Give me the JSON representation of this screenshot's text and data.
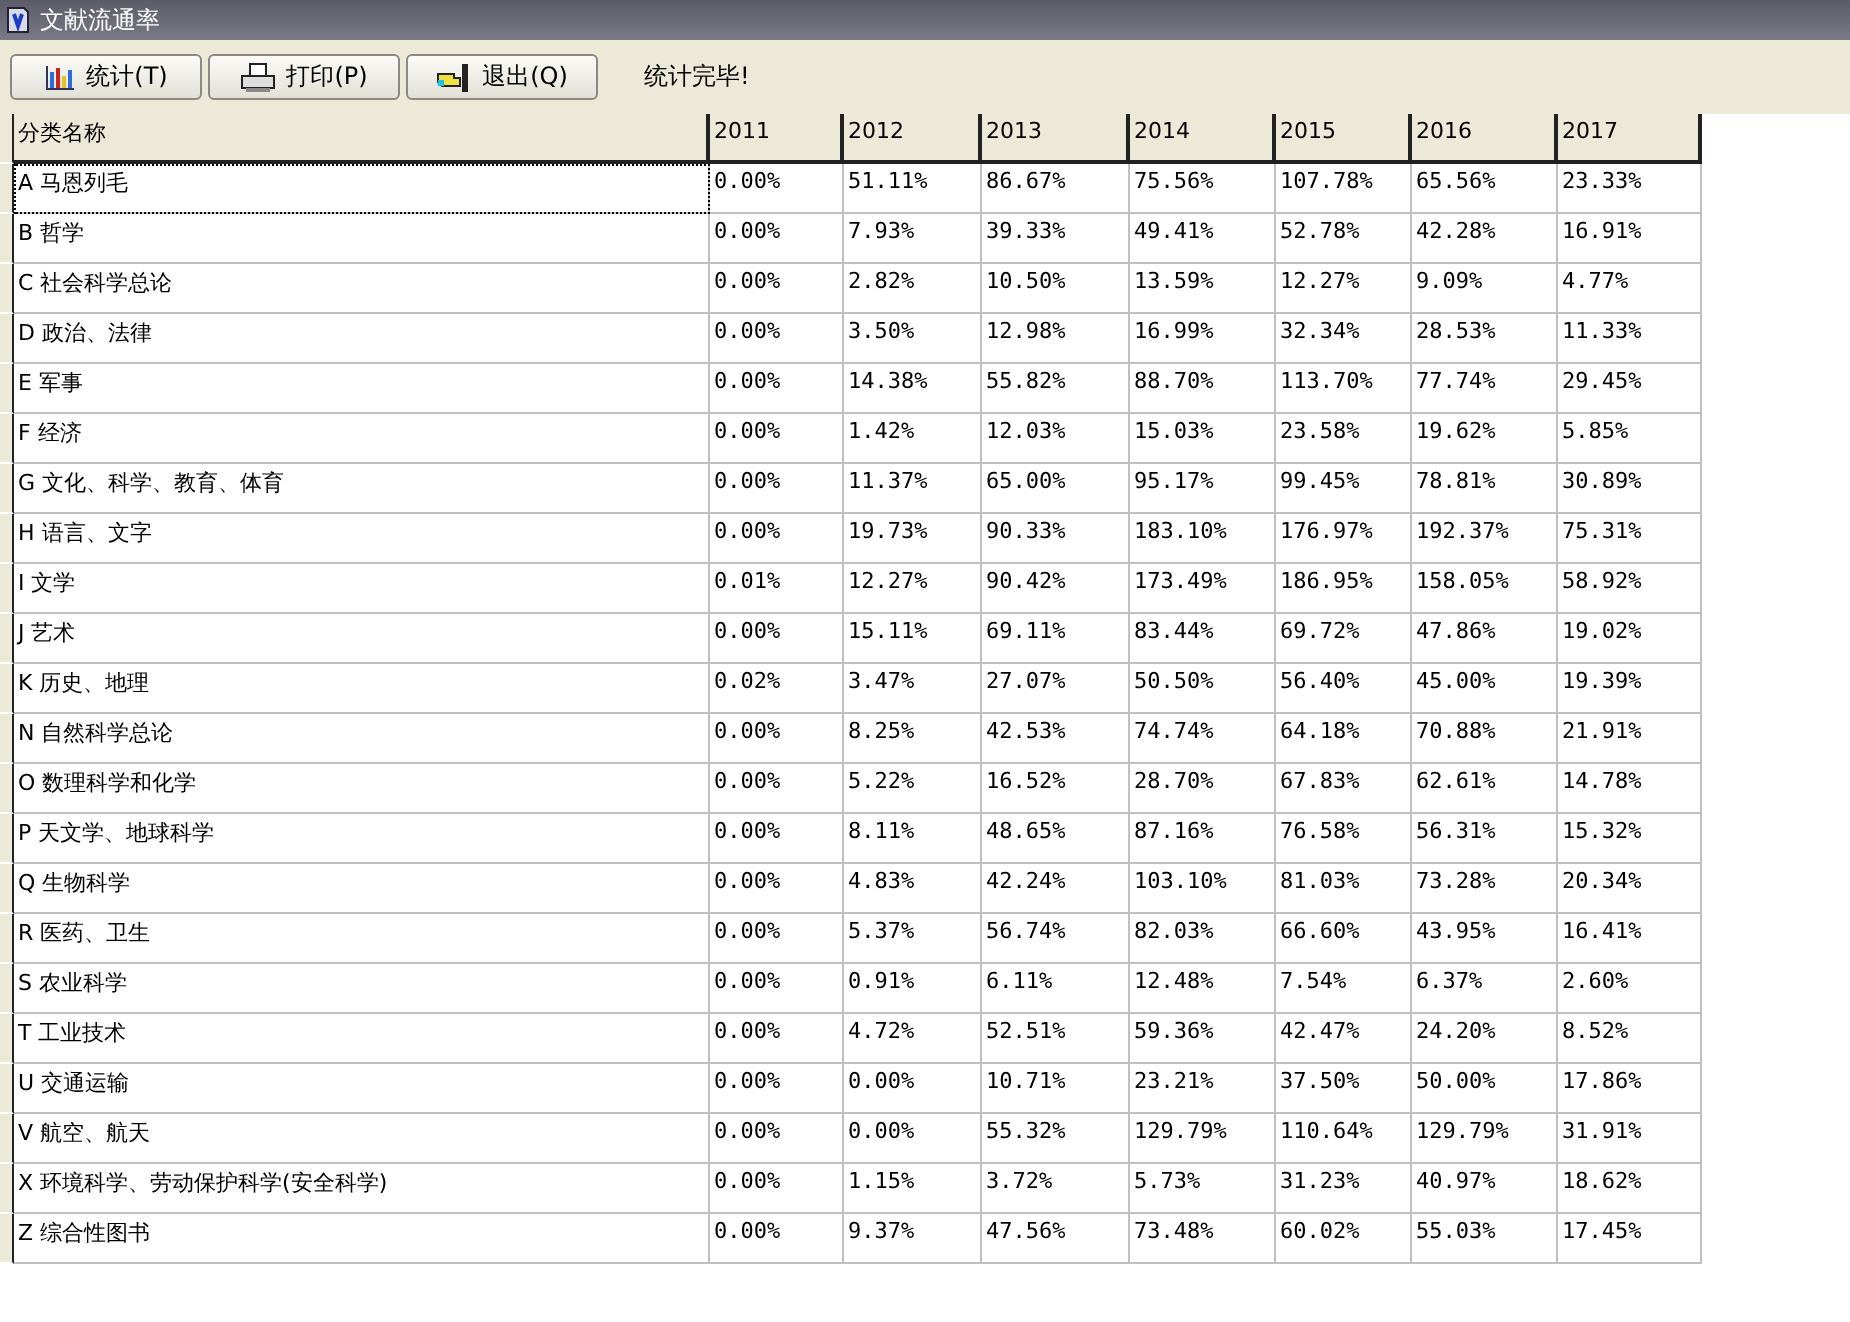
{
  "window": {
    "title": "文献流通率"
  },
  "toolbar": {
    "buttons": [
      {
        "kind": "chart",
        "label": "统计(T)"
      },
      {
        "kind": "print",
        "label": "打印(P)"
      },
      {
        "kind": "exit",
        "label": "退出(Q)"
      }
    ],
    "status": "统计完毕!"
  },
  "table": {
    "columns": [
      "分类名称",
      "2011",
      "2012",
      "2013",
      "2014",
      "2015",
      "2016",
      "2017"
    ],
    "rows": [
      {
        "focused": true,
        "cells": [
          "A 马恩列毛",
          "0.00%",
          "51.11%",
          "86.67%",
          "75.56%",
          "107.78%",
          "65.56%",
          "23.33%"
        ]
      },
      {
        "focused": false,
        "cells": [
          "B 哲学",
          "0.00%",
          "7.93%",
          "39.33%",
          "49.41%",
          "52.78%",
          "42.28%",
          "16.91%"
        ]
      },
      {
        "focused": false,
        "cells": [
          "C 社会科学总论",
          "0.00%",
          "2.82%",
          "10.50%",
          "13.59%",
          "12.27%",
          "9.09%",
          "4.77%"
        ]
      },
      {
        "focused": false,
        "cells": [
          "D 政治、法律",
          "0.00%",
          "3.50%",
          "12.98%",
          "16.99%",
          "32.34%",
          "28.53%",
          "11.33%"
        ]
      },
      {
        "focused": false,
        "cells": [
          "E 军事",
          "0.00%",
          "14.38%",
          "55.82%",
          "88.70%",
          "113.70%",
          "77.74%",
          "29.45%"
        ]
      },
      {
        "focused": false,
        "cells": [
          "F 经济",
          "0.00%",
          "1.42%",
          "12.03%",
          "15.03%",
          "23.58%",
          "19.62%",
          "5.85%"
        ]
      },
      {
        "focused": false,
        "cells": [
          "G 文化、科学、教育、体育",
          "0.00%",
          "11.37%",
          "65.00%",
          "95.17%",
          "99.45%",
          "78.81%",
          "30.89%"
        ]
      },
      {
        "focused": false,
        "cells": [
          "H 语言、文字",
          "0.00%",
          "19.73%",
          "90.33%",
          "183.10%",
          "176.97%",
          "192.37%",
          "75.31%"
        ]
      },
      {
        "focused": false,
        "cells": [
          "I 文学",
          "0.01%",
          "12.27%",
          "90.42%",
          "173.49%",
          "186.95%",
          "158.05%",
          "58.92%"
        ]
      },
      {
        "focused": false,
        "cells": [
          "J 艺术",
          "0.00%",
          "15.11%",
          "69.11%",
          "83.44%",
          "69.72%",
          "47.86%",
          "19.02%"
        ]
      },
      {
        "focused": false,
        "cells": [
          "K 历史、地理",
          "0.02%",
          "3.47%",
          "27.07%",
          "50.50%",
          "56.40%",
          "45.00%",
          "19.39%"
        ]
      },
      {
        "focused": false,
        "cells": [
          "N 自然科学总论",
          "0.00%",
          "8.25%",
          "42.53%",
          "74.74%",
          "64.18%",
          "70.88%",
          "21.91%"
        ]
      },
      {
        "focused": false,
        "cells": [
          "O 数理科学和化学",
          "0.00%",
          "5.22%",
          "16.52%",
          "28.70%",
          "67.83%",
          "62.61%",
          "14.78%"
        ]
      },
      {
        "focused": false,
        "cells": [
          "P 天文学、地球科学",
          "0.00%",
          "8.11%",
          "48.65%",
          "87.16%",
          "76.58%",
          "56.31%",
          "15.32%"
        ]
      },
      {
        "focused": false,
        "cells": [
          "Q 生物科学",
          "0.00%",
          "4.83%",
          "42.24%",
          "103.10%",
          "81.03%",
          "73.28%",
          "20.34%"
        ]
      },
      {
        "focused": false,
        "cells": [
          "R 医药、卫生",
          "0.00%",
          "5.37%",
          "56.74%",
          "82.03%",
          "66.60%",
          "43.95%",
          "16.41%"
        ]
      },
      {
        "focused": false,
        "cells": [
          "S 农业科学",
          "0.00%",
          "0.91%",
          "6.11%",
          "12.48%",
          "7.54%",
          "6.37%",
          "2.60%"
        ]
      },
      {
        "focused": false,
        "cells": [
          "T 工业技术",
          "0.00%",
          "4.72%",
          "52.51%",
          "59.36%",
          "42.47%",
          "24.20%",
          "8.52%"
        ]
      },
      {
        "focused": false,
        "cells": [
          "U 交通运输",
          "0.00%",
          "0.00%",
          "10.71%",
          "23.21%",
          "37.50%",
          "50.00%",
          "17.86%"
        ]
      },
      {
        "focused": false,
        "cells": [
          "V 航空、航天",
          "0.00%",
          "0.00%",
          "55.32%",
          "129.79%",
          "110.64%",
          "129.79%",
          "31.91%"
        ]
      },
      {
        "focused": false,
        "cells": [
          "X 环境科学、劳动保护科学(安全科学)",
          "0.00%",
          "1.15%",
          "3.72%",
          "5.73%",
          "31.23%",
          "40.97%",
          "18.62%"
        ]
      },
      {
        "focused": false,
        "cells": [
          "Z 综合性图书",
          "0.00%",
          "9.37%",
          "47.56%",
          "73.48%",
          "60.02%",
          "55.03%",
          "17.45%"
        ]
      }
    ]
  }
}
